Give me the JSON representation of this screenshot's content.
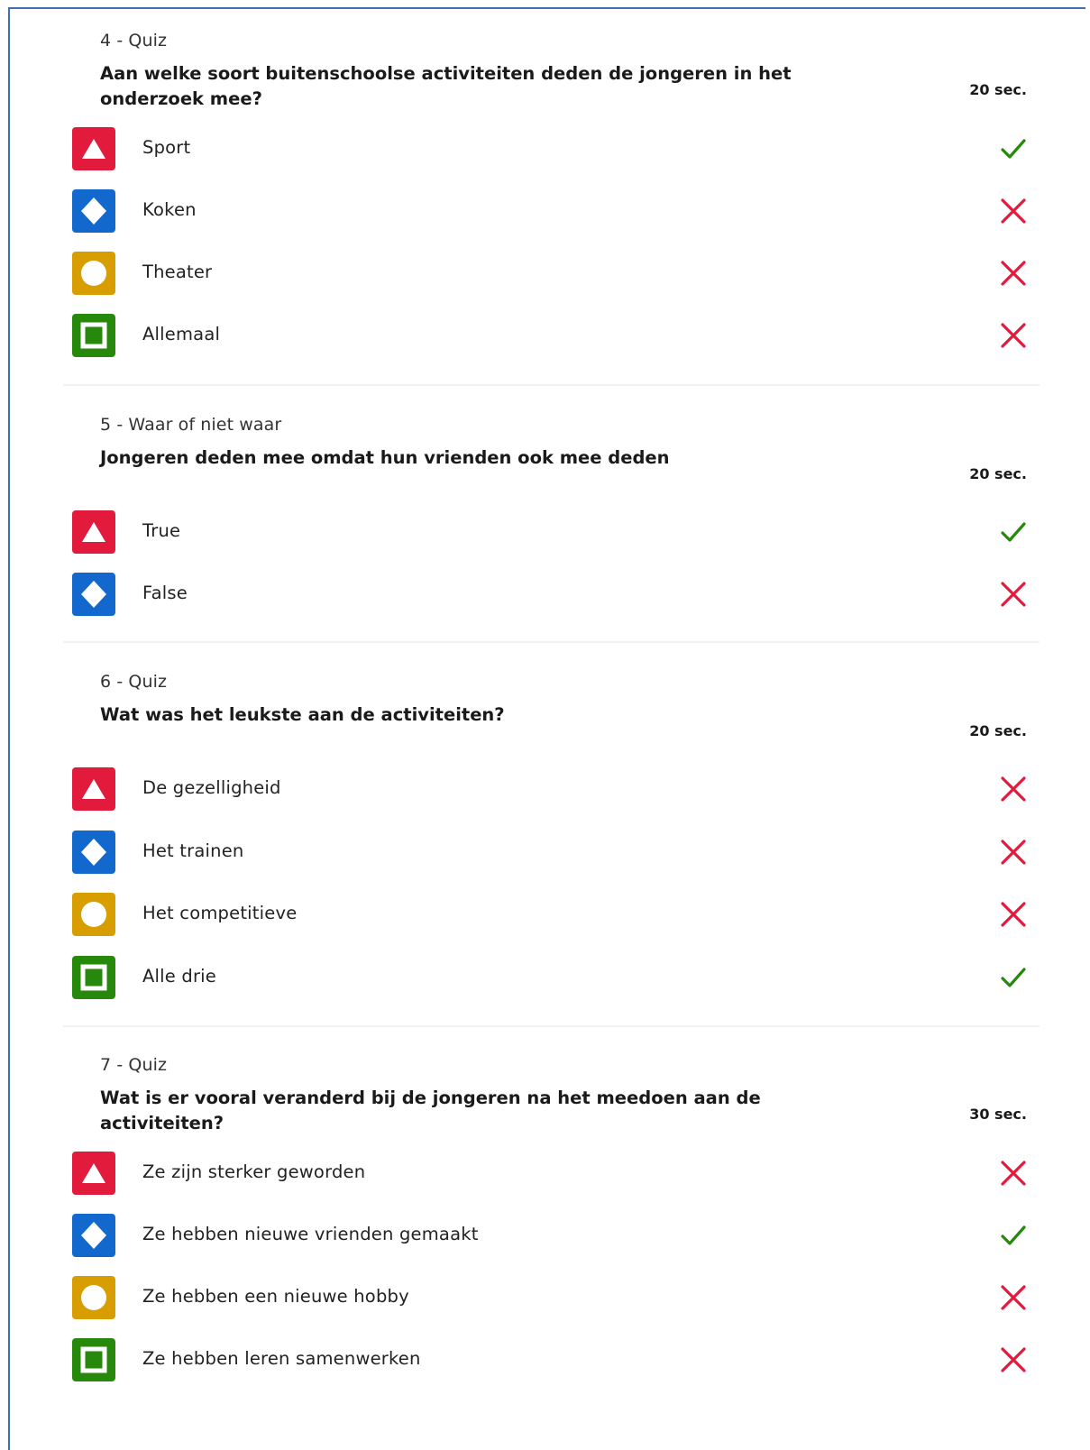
{
  "colors": {
    "red": "#e21b3c",
    "blue": "#1368ce",
    "yellow": "#d89e00",
    "green": "#26890c",
    "correct": "#26890c",
    "wrong": "#e21b3c"
  },
  "questions": [
    {
      "type_label": "4 - Quiz",
      "title": "Aan welke soort buitenschoolse activiteiten deden de jongeren in het onderzoek mee?",
      "time": "20 sec.",
      "answers": [
        {
          "shape": "triangle-icon",
          "label": "Sport",
          "correct": true
        },
        {
          "shape": "diamond-icon",
          "label": "Koken",
          "correct": false
        },
        {
          "shape": "circle-icon",
          "label": "Theater",
          "correct": false
        },
        {
          "shape": "square-icon",
          "label": "Allemaal",
          "correct": false
        }
      ]
    },
    {
      "type_label": "5 - Waar of niet waar",
      "title": "Jongeren deden mee omdat hun vrienden ook mee deden",
      "time": "20 sec.",
      "answers": [
        {
          "shape": "triangle-icon",
          "label": "True",
          "correct": true
        },
        {
          "shape": "diamond-icon",
          "label": "False",
          "correct": false
        }
      ]
    },
    {
      "type_label": "6 - Quiz",
      "title": "Wat was het leukste aan de activiteiten?",
      "time": "20 sec.",
      "answers": [
        {
          "shape": "triangle-icon",
          "label": "De gezelligheid",
          "correct": false
        },
        {
          "shape": "diamond-icon",
          "label": "Het trainen",
          "correct": false
        },
        {
          "shape": "circle-icon",
          "label": "Het competitieve",
          "correct": false
        },
        {
          "shape": "square-icon",
          "label": "Alle drie",
          "correct": true
        }
      ]
    },
    {
      "type_label": "7 - Quiz",
      "title": "Wat is er vooral veranderd bij de jongeren na het meedoen aan de activiteiten?",
      "time": "30 sec.",
      "answers": [
        {
          "shape": "triangle-icon",
          "label": "Ze zijn sterker geworden",
          "correct": false
        },
        {
          "shape": "diamond-icon",
          "label": "Ze hebben nieuwe vrienden gemaakt",
          "correct": true
        },
        {
          "shape": "circle-icon",
          "label": "Ze hebben een nieuwe hobby",
          "correct": false
        },
        {
          "shape": "square-icon",
          "label": "Ze hebben leren samenwerken",
          "correct": false
        }
      ]
    }
  ]
}
